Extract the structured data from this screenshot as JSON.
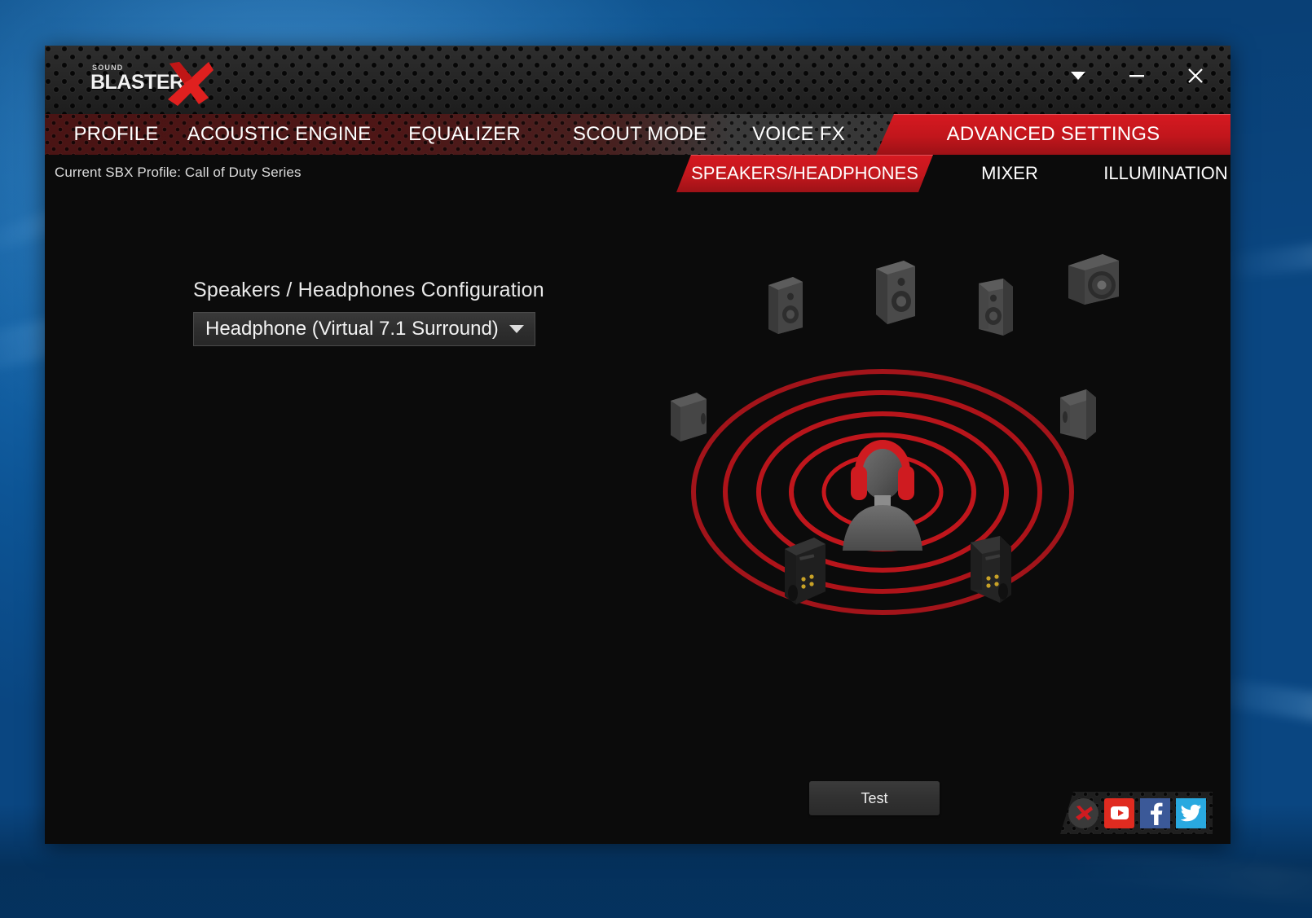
{
  "window": {
    "logo": {
      "top_text": "SOUND",
      "main_text": "BLASTER",
      "mark": "x-logo"
    },
    "controls": [
      {
        "name": "dropdown-caret",
        "glyph": "▼"
      },
      {
        "name": "minimize",
        "glyph": "—"
      },
      {
        "name": "close",
        "glyph": "✕"
      }
    ]
  },
  "tabs": [
    {
      "label": "PROFILE",
      "active": false
    },
    {
      "label": "ACOUSTIC ENGINE",
      "active": false
    },
    {
      "label": "EQUALIZER",
      "active": false
    },
    {
      "label": "SCOUT MODE",
      "active": false
    },
    {
      "label": "VOICE FX",
      "active": false
    },
    {
      "label": "ADVANCED SETTINGS",
      "active": true
    }
  ],
  "subbar": {
    "profile_status": "Current SBX Profile: Call of Duty Series",
    "subtabs": [
      {
        "label": "SPEAKERS/HEADPHONES",
        "active": true
      },
      {
        "label": "MIXER",
        "active": false
      },
      {
        "label": "ILLUMINATION",
        "active": false
      }
    ]
  },
  "main": {
    "config_label": "Speakers / Headphones Configuration",
    "config_value": "Headphone (Virtual 7.1 Surround)",
    "config_caret": "▼",
    "test_button": "Test"
  },
  "diagram": {
    "name": "virtual-surround-diagram",
    "listener": "person-with-headphones",
    "ring_color": "#a81217",
    "speakers": [
      {
        "name": "front-left-speaker",
        "type": "bookshelf"
      },
      {
        "name": "front-center-speaker",
        "type": "bookshelf"
      },
      {
        "name": "front-right-speaker",
        "type": "bookshelf"
      },
      {
        "name": "subwoofer",
        "type": "subwoofer"
      },
      {
        "name": "side-left-speaker",
        "type": "satellite"
      },
      {
        "name": "side-right-speaker",
        "type": "satellite"
      },
      {
        "name": "rear-left-speaker",
        "type": "tower"
      },
      {
        "name": "rear-right-speaker",
        "type": "tower"
      }
    ]
  },
  "social": [
    {
      "name": "soundblaster-icon",
      "color": "#3a3a3a"
    },
    {
      "name": "youtube-icon",
      "color": "#e02b20"
    },
    {
      "name": "facebook-icon",
      "color": "#3b5998"
    },
    {
      "name": "twitter-icon",
      "color": "#29a9e0"
    }
  ]
}
